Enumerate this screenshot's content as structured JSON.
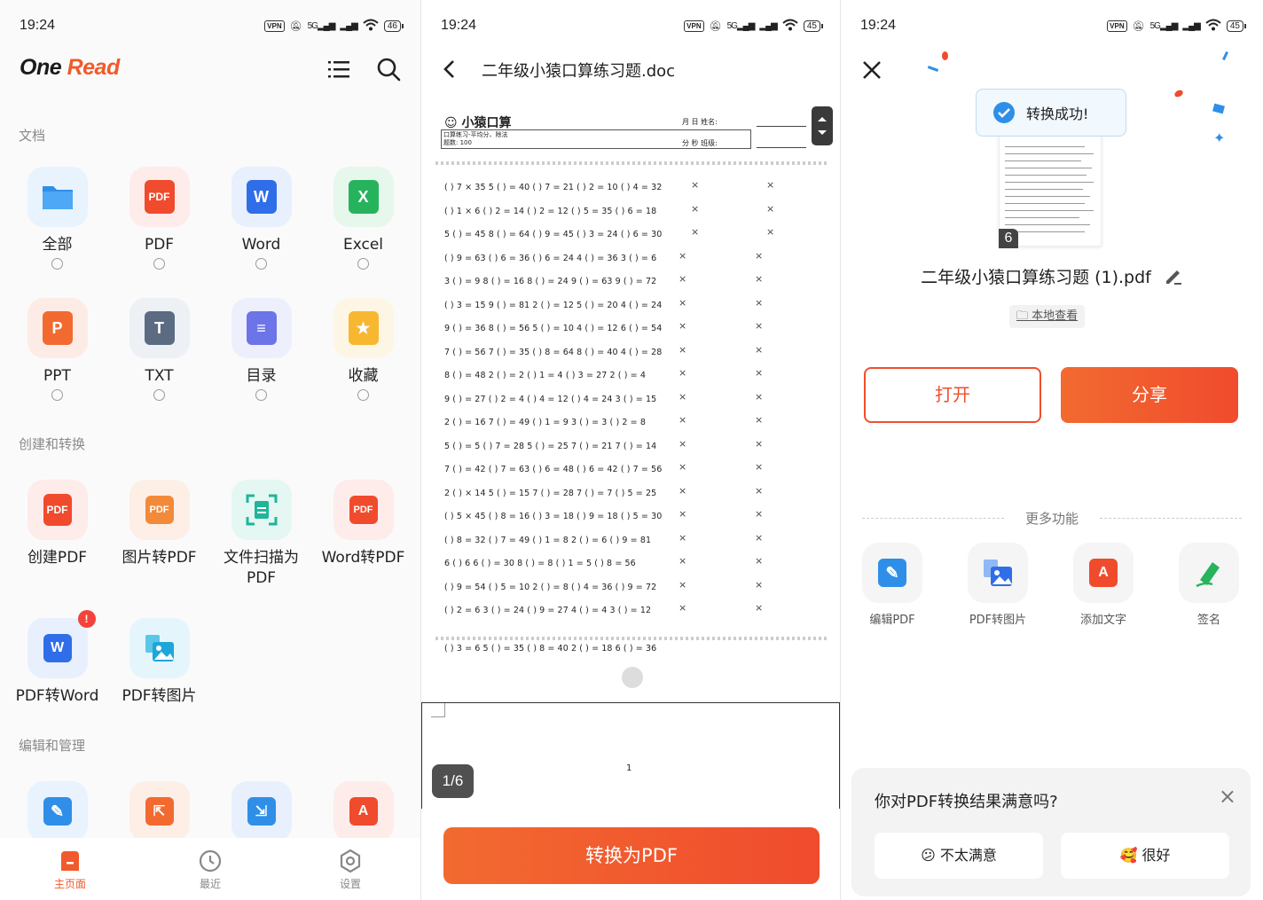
{
  "status": {
    "time": "19:24",
    "vpn": "VPN",
    "net": "5G",
    "battery_left": "46",
    "battery_mid": "45",
    "battery_right": "45"
  },
  "home": {
    "logo_one": "One",
    "logo_read": "Read",
    "sections": {
      "docs": "文档",
      "create": "创建和转换",
      "edit": "编辑和管理"
    },
    "doc_tiles": [
      "全部",
      "PDF",
      "Word",
      "Excel",
      "PPT",
      "TXT",
      "目录",
      "收藏"
    ],
    "create_tiles": [
      "创建PDF",
      "图片转PDF",
      "文件扫描为PDF",
      "Word转PDF",
      "PDF转Word",
      "PDF转图片"
    ],
    "badge": "!",
    "nav": {
      "home": "主页面",
      "recent": "最近",
      "settings": "设置"
    }
  },
  "viewer": {
    "title": "二年级小猿口算练习题.doc",
    "sheet_title": "小猿口算",
    "sheet_sub": "口算练习-平均分、除法",
    "sheet_count": "题数: 100",
    "name_label": "月 日 姓名:",
    "class_label": "分 秒 班级:",
    "rows": [
      "( ) 7 × 35 5 ( ) = 40 ( ) 7 = 21 ( ) 2 = 10 ( ) 4 = 32",
      "( ) 1 × 6 ( ) 2 = 14 ( ) 2 = 12 ( ) 5 = 35 ( ) 6 = 18",
      "5 ( ) = 45 8 ( ) = 64 ( ) 9 = 45 ( ) 3 = 24 ( ) 6 = 30",
      "( ) 9 = 63 ( ) 6 = 36 ( ) 6 = 24 4 ( ) = 36 3 ( ) = 6",
      "3 ( ) = 9 8 ( ) = 16 8 ( ) = 24 9 ( ) = 63 9 ( ) = 72",
      "( ) 3 = 15 9 ( ) = 81 2 ( ) = 12 5 ( ) = 20 4 ( ) = 24",
      "9 ( ) = 36 8 ( ) = 56 5 ( ) = 10 4 ( ) = 12 6 ( ) = 54",
      "7 ( ) = 56 7 ( ) = 35 ( ) 8 = 64 8 ( ) = 40 4 ( ) = 28",
      "8 ( ) = 48 2 ( ) = 2 ( ) 1 = 4 ( ) 3 = 27 2 ( ) = 4",
      "9 ( ) = 27 ( ) 2 = 4 ( ) 4 = 12 ( ) 4 = 24 3 ( ) = 15",
      "2 ( ) = 16 7 ( ) = 49 ( ) 1 = 9 3 ( ) = 3 ( ) 2 = 8",
      "5 ( ) = 5 ( ) 7 = 28 5 ( ) = 25 7 ( ) = 21 7 ( ) = 14",
      "7 ( ) = 42 ( ) 7 = 63 ( ) 6 = 48 ( ) 6 = 42 ( ) 7 = 56",
      "2 ( ) × 14 5 ( ) = 15 7 ( ) = 28 7 ( ) = 7 ( ) 5 = 25",
      "( ) 5 × 45 ( ) 8 = 16 ( ) 3 = 18 ( ) 9 = 18 ( ) 5 = 30",
      "( ) 8 = 32 ( ) 7 = 49 ( ) 1 = 8 2 ( ) = 6 ( ) 9 = 81",
      "6 ( ) 6 6 ( ) = 30 8 ( ) = 8 ( ) 1 = 5 ( ) 8 = 56",
      "( ) 9 = 54 ( ) 5 = 10 2 ( ) = 8 ( ) 4 = 36 ( ) 9 = 72",
      "( ) 2 = 6 3 ( ) = 24 ( ) 9 = 27 4 ( ) = 4 3 ( ) = 12"
    ],
    "next_row": "( ) 3 = 6 5 ( ) = 35 ( ) 8 = 40 2 ( ) = 18 6 ( ) = 36",
    "mark": "×",
    "page_footer_num": "1",
    "page_indicator": "1/6",
    "convert_button": "转换为PDF"
  },
  "result": {
    "toast": "转换成功!",
    "page_count": "6",
    "filename": "二年级小猿口算练习题 (1).pdf",
    "local_view": "本地查看",
    "open": "打开",
    "share": "分享",
    "more": "更多功能",
    "features": [
      "编辑PDF",
      "PDF转图片",
      "添加文字",
      "签名"
    ],
    "survey_question": "你对PDF转换结果满意吗?",
    "survey_close": "×",
    "survey_bad": "不太满意",
    "survey_good": "很好",
    "emoji_bad": "😕",
    "emoji_good": "🥰"
  },
  "colors": {
    "accent": "#f15a2b",
    "blue": "#2f8fe8",
    "green": "#27b35c",
    "purple": "#6c74e8",
    "yellow": "#f7b731"
  }
}
